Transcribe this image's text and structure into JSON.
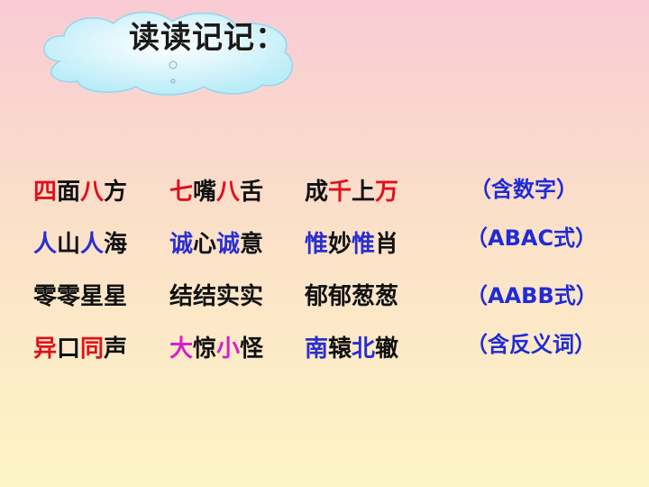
{
  "title": "读读记记：",
  "colors": {
    "red": "#e10f1a",
    "blue": "#2b2fd0",
    "magenta": "#d41fc8",
    "black": "#111111",
    "note": "#1f2bd6"
  },
  "rows": [
    {
      "idioms": [
        [
          {
            "t": "四",
            "c": "red"
          },
          {
            "t": "面",
            "c": "black"
          },
          {
            "t": "八",
            "c": "red"
          },
          {
            "t": "方",
            "c": "black"
          }
        ],
        [
          {
            "t": "七",
            "c": "red"
          },
          {
            "t": "嘴",
            "c": "black"
          },
          {
            "t": "八",
            "c": "red"
          },
          {
            "t": "舌",
            "c": "black"
          }
        ],
        [
          {
            "t": "成",
            "c": "black"
          },
          {
            "t": "千",
            "c": "red"
          },
          {
            "t": "上",
            "c": "black"
          },
          {
            "t": "万",
            "c": "red"
          }
        ]
      ],
      "note": "（含数字）"
    },
    {
      "idioms": [
        [
          {
            "t": "人",
            "c": "blue"
          },
          {
            "t": "山",
            "c": "black"
          },
          {
            "t": "人",
            "c": "blue"
          },
          {
            "t": "海",
            "c": "black"
          }
        ],
        [
          {
            "t": "诚",
            "c": "blue"
          },
          {
            "t": "心",
            "c": "black"
          },
          {
            "t": "诚",
            "c": "blue"
          },
          {
            "t": "意",
            "c": "black"
          }
        ],
        [
          {
            "t": "惟",
            "c": "blue"
          },
          {
            "t": "妙",
            "c": "black"
          },
          {
            "t": "惟",
            "c": "blue"
          },
          {
            "t": "肖",
            "c": "black"
          }
        ]
      ],
      "note": "（ABAC式）"
    },
    {
      "idioms": [
        [
          {
            "t": "零",
            "c": "black"
          },
          {
            "t": "零",
            "c": "black"
          },
          {
            "t": "星",
            "c": "black"
          },
          {
            "t": "星",
            "c": "black"
          }
        ],
        [
          {
            "t": "结",
            "c": "black"
          },
          {
            "t": "结",
            "c": "black"
          },
          {
            "t": "实",
            "c": "black"
          },
          {
            "t": "实",
            "c": "black"
          }
        ],
        [
          {
            "t": "郁",
            "c": "black"
          },
          {
            "t": "郁",
            "c": "black"
          },
          {
            "t": "葱",
            "c": "black"
          },
          {
            "t": "葱",
            "c": "black"
          }
        ]
      ],
      "note": "（AABB式）"
    },
    {
      "idioms": [
        [
          {
            "t": "异",
            "c": "red"
          },
          {
            "t": "口",
            "c": "black"
          },
          {
            "t": "同",
            "c": "red"
          },
          {
            "t": "声",
            "c": "black"
          }
        ],
        [
          {
            "t": "大",
            "c": "magenta"
          },
          {
            "t": "惊",
            "c": "black"
          },
          {
            "t": "小",
            "c": "magenta"
          },
          {
            "t": "怪",
            "c": "black"
          }
        ],
        [
          {
            "t": "南",
            "c": "blue"
          },
          {
            "t": "辕",
            "c": "black"
          },
          {
            "t": "北",
            "c": "blue"
          },
          {
            "t": "辙",
            "c": "black"
          }
        ]
      ],
      "note": "（含反义词）"
    }
  ]
}
